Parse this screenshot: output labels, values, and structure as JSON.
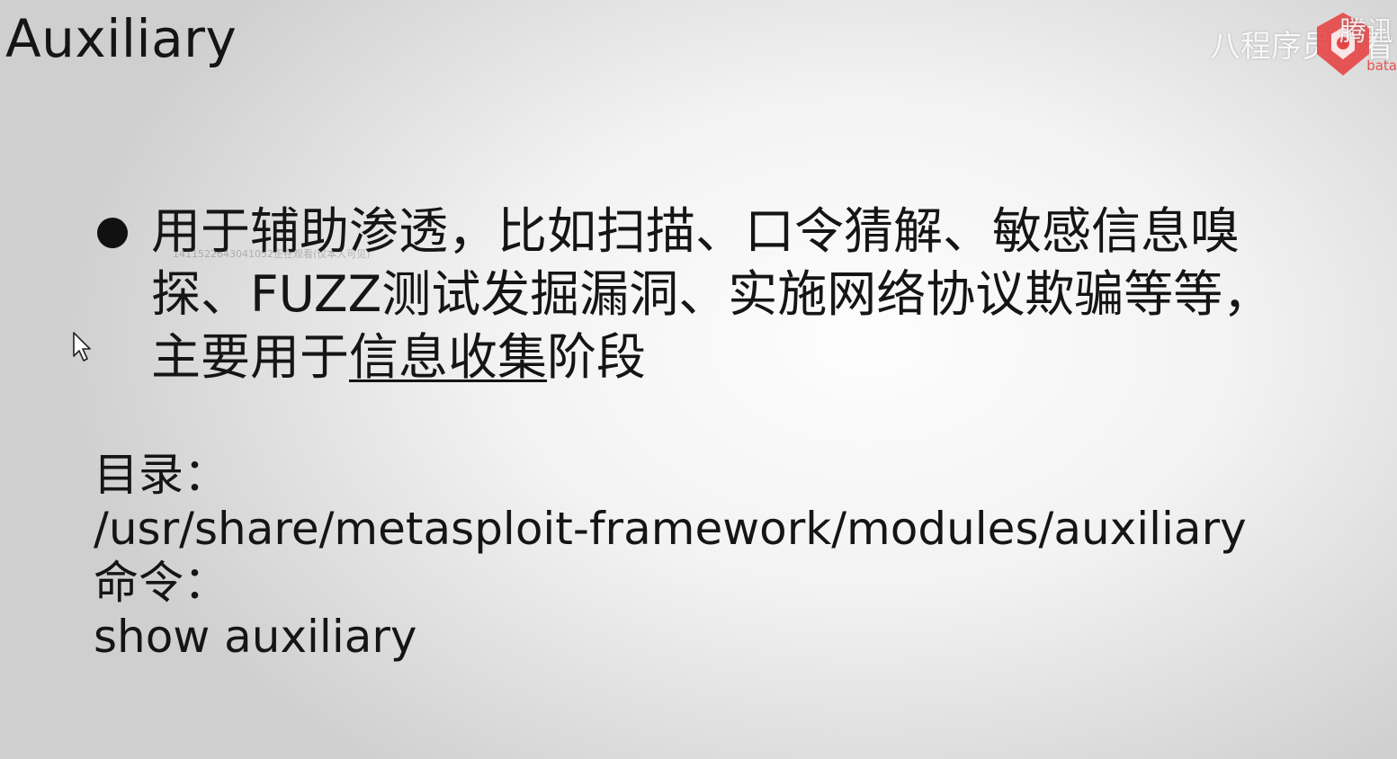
{
  "slide": {
    "title": "Auxiliary",
    "bullet": {
      "lines": [
        "用于辅助渗透，比如扫描、口令猜解、敏感信息嗅",
        "探、FUZZ测试发掘漏洞、实施网络协议欺骗等等，"
      ],
      "line3_prefix": "主要用于",
      "line3_underlined": "信息收集",
      "line3_suffix": "阶段"
    },
    "overlay_text": "1411522643041052正在观看(仅本人可见)",
    "directory_label": "目录：",
    "directory_path": "/usr/share/metasploit-framework/modules/auxiliary",
    "command_label": "命令：",
    "command_value": "show auxiliary"
  },
  "watermark": {
    "channel_text": "八程序员看看",
    "brand_text": "腾讯",
    "brand_sub": "bata",
    "side_text": "八"
  },
  "colors": {
    "text": "#151515",
    "logo_red": "#e64545"
  }
}
